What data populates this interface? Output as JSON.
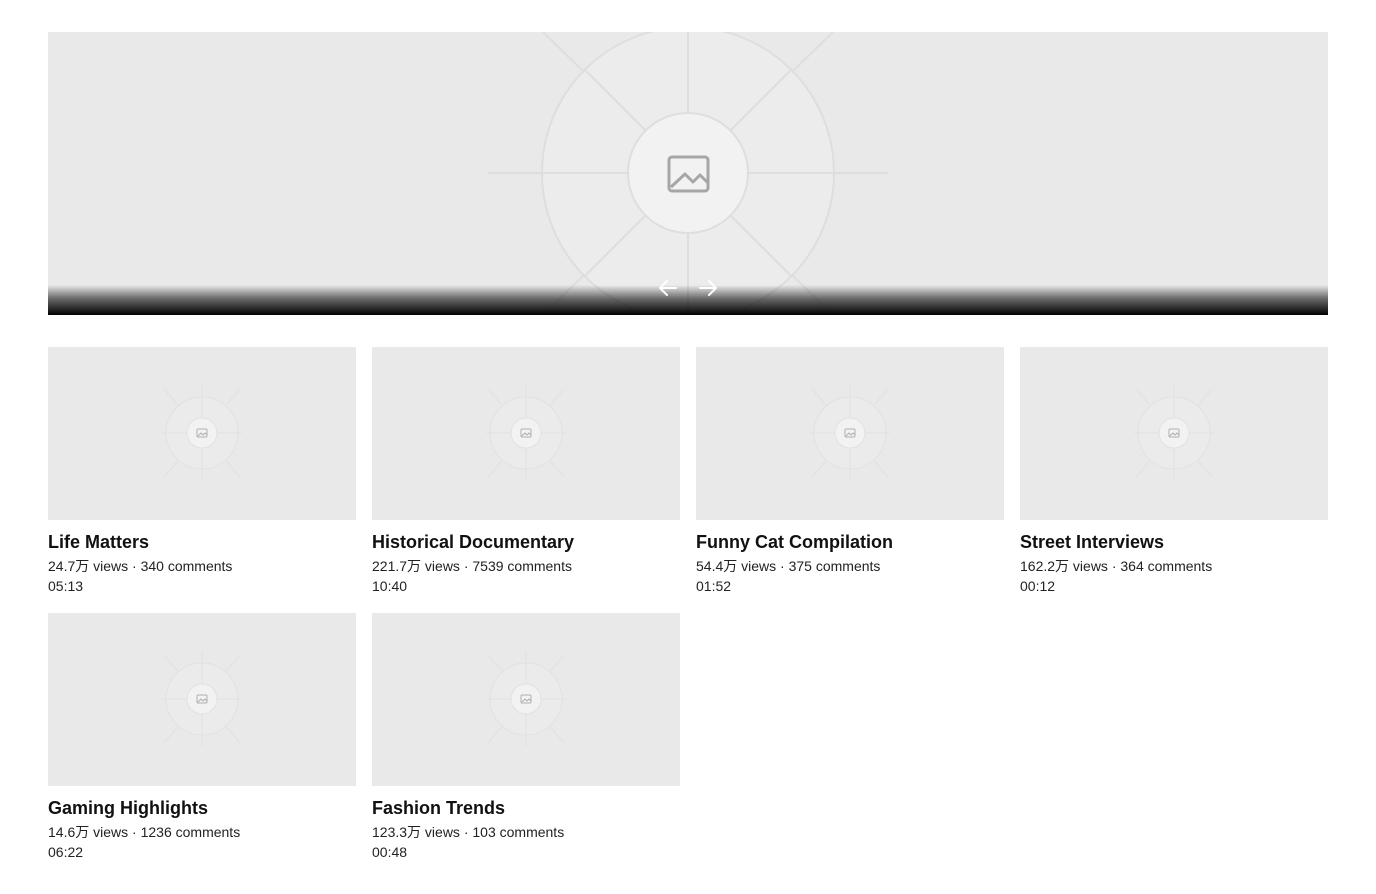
{
  "hero": {
    "image_icon": "image-placeholder-icon",
    "prev_icon": "arrow-left-icon",
    "next_icon": "arrow-right-icon"
  },
  "videos": [
    {
      "title": "Life Matters",
      "views": "24.7万",
      "comments": "340",
      "meta": "24.7万 views · 340 comments",
      "duration": "05:13"
    },
    {
      "title": "Historical Documentary",
      "views": "221.7万",
      "comments": "7539",
      "meta": "221.7万 views · 7539 comments",
      "duration": "10:40"
    },
    {
      "title": "Funny Cat Compilation",
      "views": "54.4万",
      "comments": "375",
      "meta": "54.4万 views · 375 comments",
      "duration": "01:52"
    },
    {
      "title": "Street Interviews",
      "views": "162.2万",
      "comments": "364",
      "meta": "162.2万 views · 364 comments",
      "duration": "00:12"
    },
    {
      "title": "Gaming Highlights",
      "views": "14.6万",
      "comments": "1236",
      "meta": "14.6万 views · 1236 comments",
      "duration": "06:22"
    },
    {
      "title": "Fashion Trends",
      "views": "123.3万",
      "comments": "103",
      "meta": "123.3万 views · 103 comments",
      "duration": "00:48"
    }
  ],
  "colors": {
    "placeholder_bg": "#e9e9e9",
    "placeholder_line": "#dcdcdc",
    "text": "#111111"
  }
}
